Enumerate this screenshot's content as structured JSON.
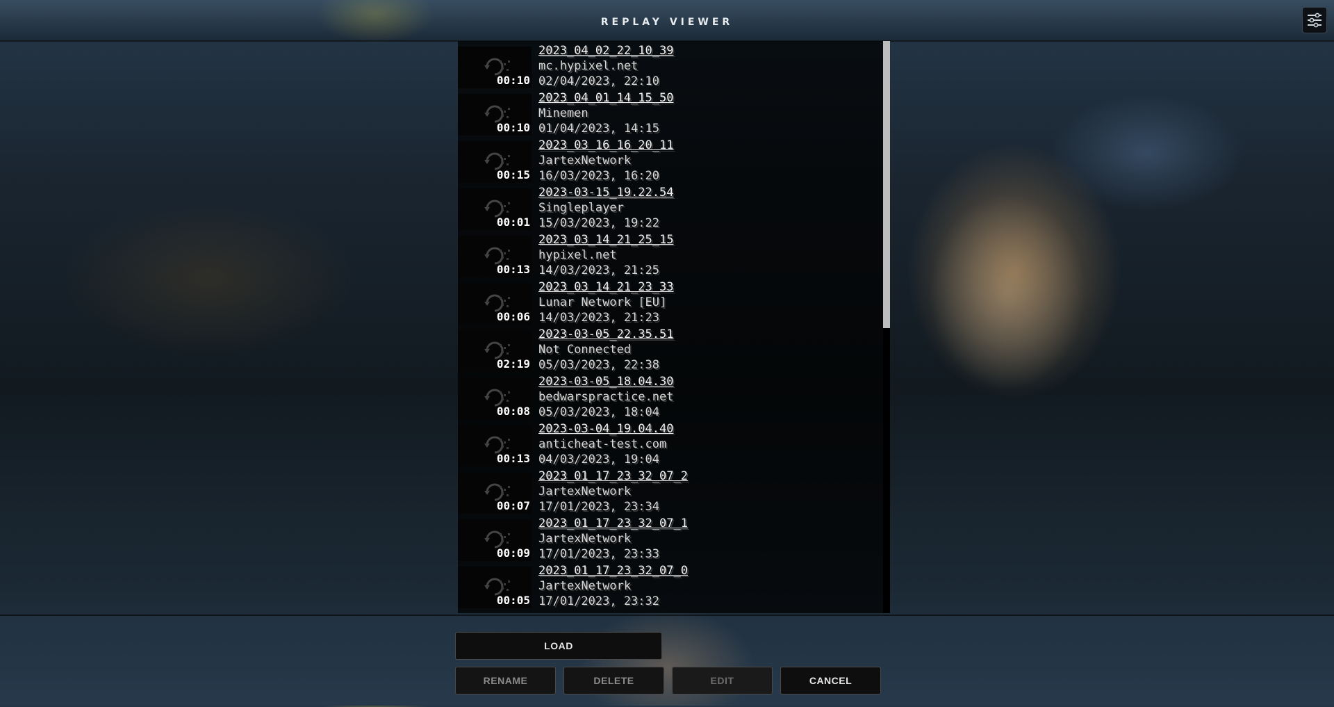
{
  "header": {
    "title": "REPLAY VIEWER",
    "settings_icon": "sliders-icon"
  },
  "replays": [
    {
      "name": "2023_04_02_22_10_39",
      "server": "mc.hypixel.net",
      "date": "02/04/2023, 22:10",
      "duration": "00:10"
    },
    {
      "name": "2023_04_01_14_15_50",
      "server": "Minemen",
      "date": "01/04/2023, 14:15",
      "duration": "00:10"
    },
    {
      "name": "2023_03_16_16_20_11",
      "server": "JartexNetwork",
      "date": "16/03/2023, 16:20",
      "duration": "00:15"
    },
    {
      "name": "2023-03-15_19.22.54",
      "server": "Singleplayer",
      "date": "15/03/2023, 19:22",
      "duration": "00:01"
    },
    {
      "name": "2023_03_14_21_25_15",
      "server": "hypixel.net",
      "date": "14/03/2023, 21:25",
      "duration": "00:13"
    },
    {
      "name": "2023_03_14_21_23_33",
      "server": "Lunar Network [EU]",
      "date": "14/03/2023, 21:23",
      "duration": "00:06"
    },
    {
      "name": "2023-03-05_22.35.51",
      "server": "Not Connected",
      "date": "05/03/2023, 22:38",
      "duration": "02:19"
    },
    {
      "name": "2023-03-05_18.04.30",
      "server": "bedwarspractice.net",
      "date": "05/03/2023, 18:04",
      "duration": "00:08"
    },
    {
      "name": "2023-03-04_19.04.40",
      "server": "anticheat-test.com",
      "date": "04/03/2023, 19:04",
      "duration": "00:13"
    },
    {
      "name": "2023_01_17_23_32_07_2",
      "server": "JartexNetwork",
      "date": "17/01/2023, 23:34",
      "duration": "00:07"
    },
    {
      "name": "2023_01_17_23_32_07_1",
      "server": "JartexNetwork",
      "date": "17/01/2023, 23:33",
      "duration": "00:09"
    },
    {
      "name": "2023_01_17_23_32_07_0",
      "server": "JartexNetwork",
      "date": "17/01/2023, 23:32",
      "duration": "00:05"
    }
  ],
  "buttons": {
    "load": "LOAD",
    "rename": "RENAME",
    "delete": "DELETE",
    "edit": "EDIT",
    "cancel": "CANCEL"
  }
}
